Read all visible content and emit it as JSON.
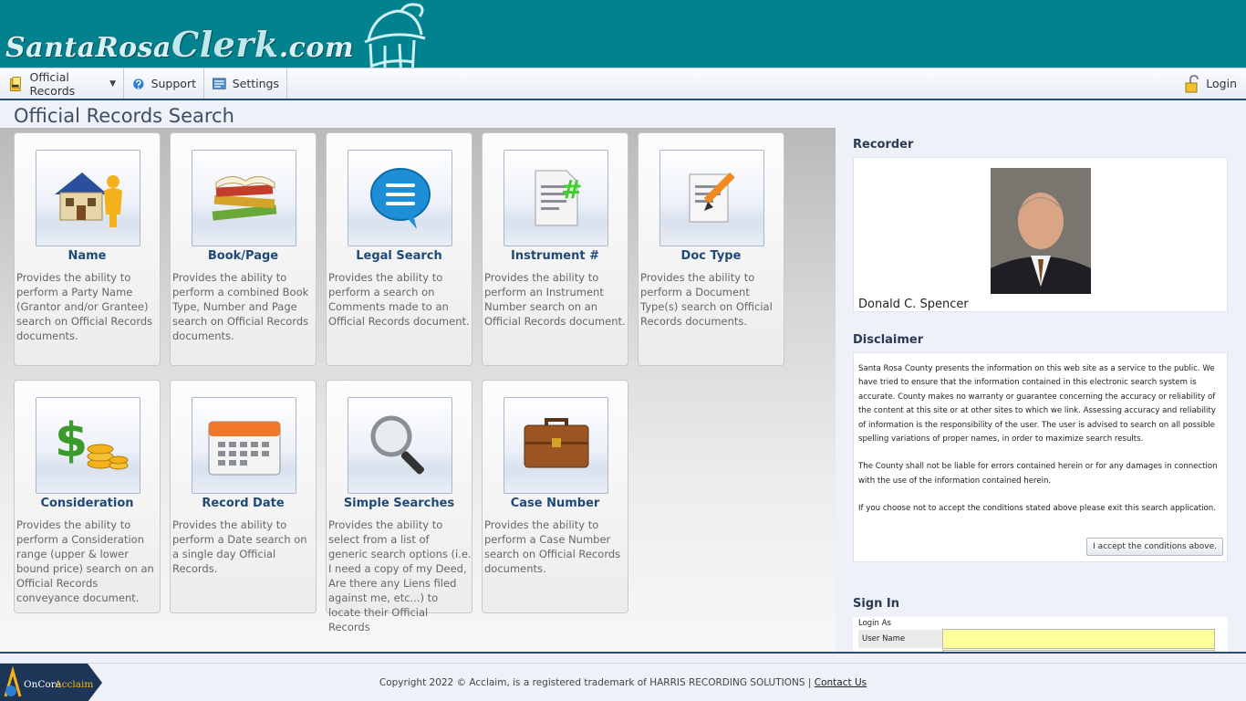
{
  "header": {
    "logo_prefix": "SantaRosa",
    "logo_main": "Clerk",
    "logo_suffix": ".com"
  },
  "nav": {
    "official_records": "Official Records",
    "support": "Support",
    "settings": "Settings",
    "login": "Login",
    "icons": [
      "records-icon",
      "support-icon",
      "settings-icon",
      "lock-icon"
    ]
  },
  "page_title": "Official Records Search",
  "tiles": [
    {
      "title": "Name",
      "desc": "Provides the ability to perform a Party Name (Grantor and/or Grantee) search on Official Records documents.",
      "icon": "house-person-icon"
    },
    {
      "title": "Book/Page",
      "desc": "Provides the ability to perform a combined Book Type, Number and Page search on Official Records documents.",
      "icon": "books-icon"
    },
    {
      "title": "Legal Search",
      "desc": "Provides the ability to perform a search on Comments made to an Official Records document.",
      "icon": "speech-bubble-icon"
    },
    {
      "title": "Instrument #",
      "desc": "Provides the ability to perform an Instrument Number search on an Official Records document.",
      "icon": "document-hash-icon"
    },
    {
      "title": "Doc Type",
      "desc": "Provides the ability to perform a Document Type(s) search on Official Records documents.",
      "icon": "document-pencil-icon"
    },
    {
      "title": "Consideration",
      "desc": "Provides the ability to perform a Consideration range (upper & lower bound price) search on an Official Records conveyance document.",
      "icon": "money-icon"
    },
    {
      "title": "Record Date",
      "desc": "Provides the ability to perform a Date search on a single day Official Records.",
      "icon": "calendar-icon"
    },
    {
      "title": "Simple Searches",
      "desc": "Provides the ability to select from a list of generic search options (i.e. I need a copy of my Deed, Are there any Liens filed against me, etc...) to locate their Official Records",
      "icon": "magnifier-icon"
    },
    {
      "title": "Case Number",
      "desc": "Provides the ability to perform a Case Number search on Official Records documents.",
      "icon": "briefcase-icon"
    }
  ],
  "recorder": {
    "heading": "Recorder",
    "name": "Donald C. Spencer"
  },
  "disclaimer": {
    "heading": "Disclaimer",
    "p1": "Santa Rosa County presents the information on this web site as a service to the public. We have tried to ensure that the information contained in this electronic search system is accurate. County makes no warranty or guarantee concerning the accuracy or reliability of the content at this site or at other sites to which we link. Assessing accuracy and reliability of information is the responsibility of the user. The user is advised to search on all possible spelling variations of proper names, in order to maximize search results.",
    "p2": "The County shall not be liable for errors contained herein or for any damages in connection with the use of the information contained herein.",
    "p3": "If you choose not to accept the conditions stated above please exit this search application.",
    "accept": "I accept the conditions above."
  },
  "signin": {
    "heading": "Sign In",
    "login_as": "Login As",
    "user_name": "User Name"
  },
  "footer": {
    "badge_a": "OnCore",
    "badge_b": "Acclaim",
    "copyright": "Copyright 2022 © Acclaim, is a registered trademark of HARRIS RECORDING SOLUTIONS | ",
    "contact": "Contact Us"
  },
  "colors": {
    "header_bg": "#00828f",
    "tile_title": "#1f4a78",
    "accent_navy": "#2d4b6e",
    "input_highlight": "#ffff99"
  }
}
